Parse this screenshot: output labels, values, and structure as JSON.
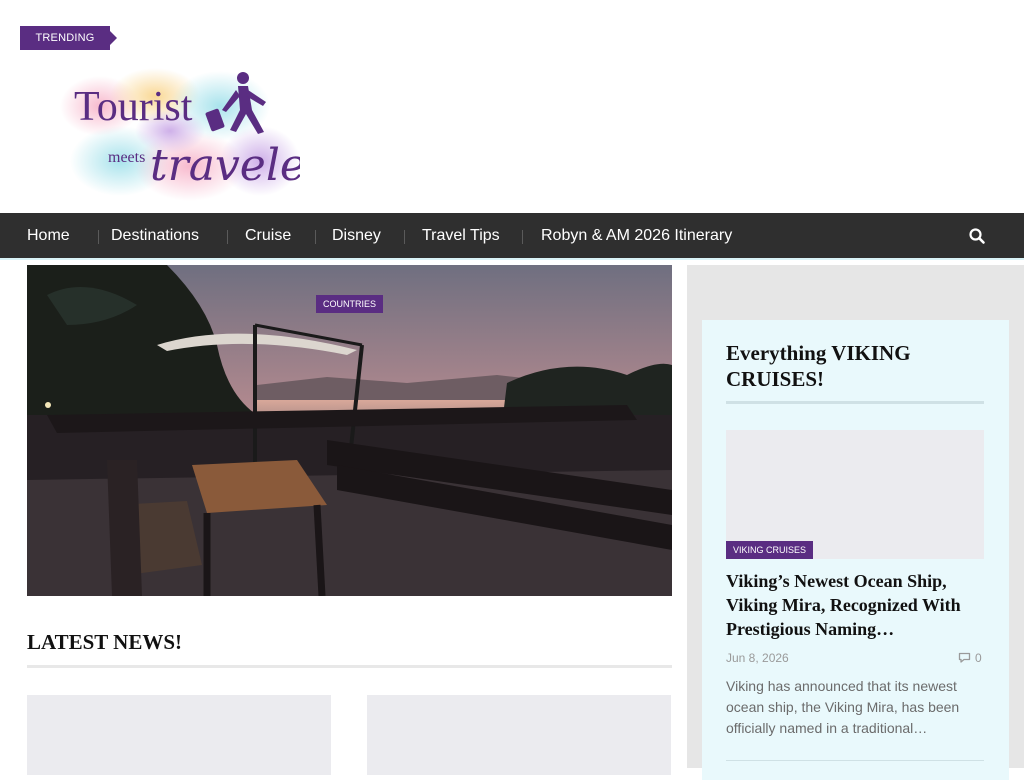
{
  "header": {
    "trending_label": "TRENDING",
    "logo": {
      "line1": "Tourist",
      "line2": "meets",
      "line3": "traveler"
    }
  },
  "nav": {
    "items": [
      {
        "label": "Home"
      },
      {
        "label": "Destinations"
      },
      {
        "label": "Cruise"
      },
      {
        "label": "Disney"
      },
      {
        "label": "Travel Tips"
      },
      {
        "label": "Robyn & AM 2026 Itinerary"
      }
    ],
    "search_icon": "search-icon"
  },
  "hero": {
    "category": "COUNTRIES"
  },
  "latest": {
    "title": "LATEST NEWS!"
  },
  "sidebar": {
    "widget_title": "Everything VIKING CRUISES!",
    "post": {
      "category": "VIKING CRUISES",
      "title": "Viking’s Newest Ocean Ship, Viking Mira, Recognized With Prestigious Naming…",
      "date": "Jun 8, 2026",
      "comments": "0",
      "comment_icon": "comment-icon",
      "excerpt": "Viking has announced that its newest ocean ship, the Viking Mira, has been officially named in a traditional…"
    }
  },
  "colors": {
    "accent": "#5a2d82",
    "nav_background": "#2f2f2f",
    "widget_background": "#e9f9fc"
  }
}
